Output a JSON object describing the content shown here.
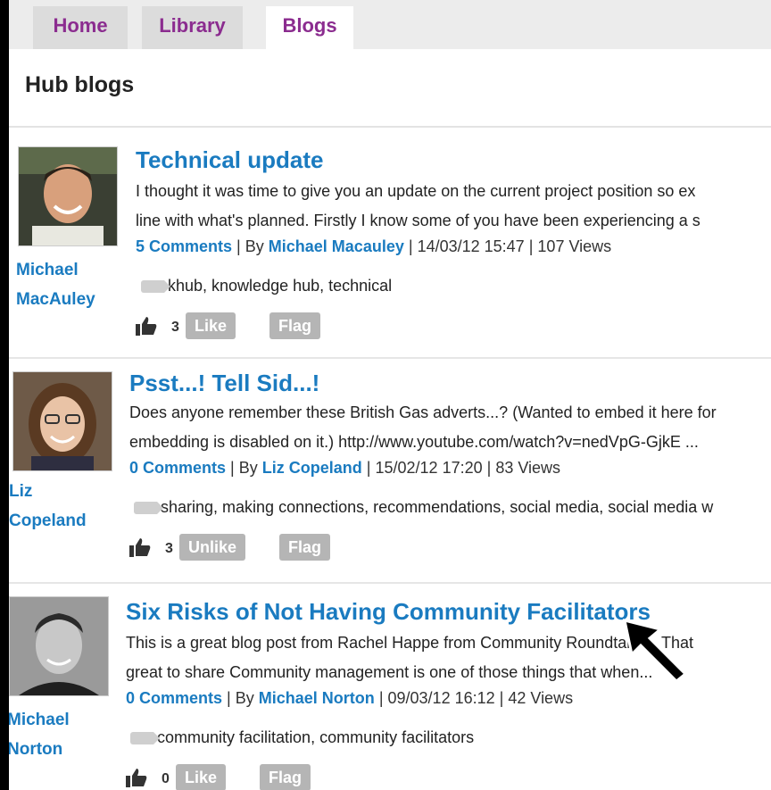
{
  "tabs": [
    {
      "label": "Home",
      "active": false
    },
    {
      "label": "Library",
      "active": false
    },
    {
      "label": "Blogs",
      "active": true
    }
  ],
  "page_title": "Hub blogs",
  "posts": [
    {
      "title": "Technical update",
      "excerpt_lines": [
        " I thought it was time to give you an update on the current project position so ex",
        "line with what's planned. Firstly I know some of you have been experiencing a s"
      ],
      "comments": "5 Comments",
      "by_label": "By",
      "author_link": "Michael Macauley",
      "date": "14/03/12 15:47",
      "views": "107 Views",
      "author_first": "Michael",
      "author_last": "MacAuley",
      "tags": "khub, knowledge hub, technical",
      "like_count": "3",
      "like_label": "Like",
      "flag_label": "Flag"
    },
    {
      "title": "Psst...! Tell Sid...!",
      "excerpt_lines": [
        "Does anyone remember these British Gas adverts...? (Wanted to embed it here for",
        "embedding is disabled on it.) http://www.youtube.com/watch?v=nedVpG-GjkE  ..."
      ],
      "comments": "0 Comments",
      "by_label": "By",
      "author_link": "Liz Copeland",
      "date": "15/02/12 17:20",
      "views": "83 Views",
      "author_first": "Liz",
      "author_last": "Copeland",
      "tags": "sharing, making connections, recommendations, social media, social media w",
      "like_count": "3",
      "like_label": "Unlike",
      "flag_label": "Flag"
    },
    {
      "title": "Six Risks of Not Having Community Facilitators",
      "excerpt_lines": [
        "This is a great blog post from Rachel Happe from Community Roundtable ,  That",
        "great to share   Community management is one of those things that when..."
      ],
      "comments": "0 Comments",
      "by_label": "By",
      "author_link": "Michael Norton",
      "date": "09/03/12 16:12",
      "views": "42 Views",
      "author_first": "Michael",
      "author_last": "Norton",
      "tags": "community facilitation, community facilitators",
      "like_count": "0",
      "like_label": "Like",
      "flag_label": "Flag"
    }
  ],
  "separator": "|",
  "colors": {
    "tab_text": "#8b2c8f",
    "link": "#1a7bc0",
    "button": "#b5b5b5"
  }
}
